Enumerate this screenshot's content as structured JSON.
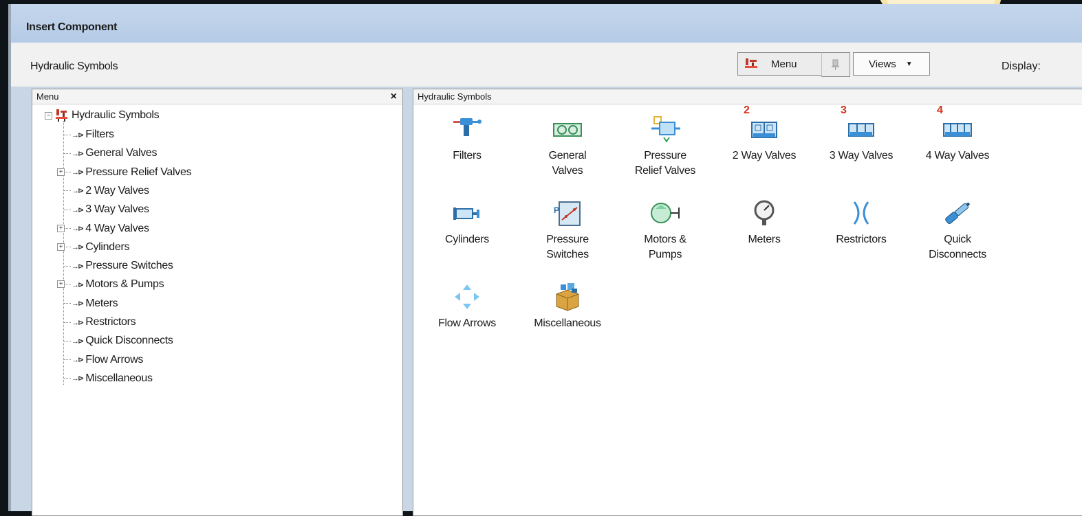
{
  "window": {
    "title": "Insert Component"
  },
  "toolbar": {
    "breadcrumb": "Hydraulic Symbols",
    "menu_button": "Menu",
    "views_button": "Views",
    "display_label": "Display:"
  },
  "left_pane": {
    "header": "Menu",
    "close_symbol": "×",
    "root": "Hydraulic Symbols",
    "items": [
      {
        "label": "Filters",
        "expandable": false
      },
      {
        "label": "General Valves",
        "expandable": false
      },
      {
        "label": "Pressure Relief Valves",
        "expandable": true
      },
      {
        "label": "2 Way Valves",
        "expandable": false
      },
      {
        "label": "3 Way Valves",
        "expandable": false
      },
      {
        "label": "4 Way Valves",
        "expandable": true
      },
      {
        "label": "Cylinders",
        "expandable": true
      },
      {
        "label": "Pressure Switches",
        "expandable": false
      },
      {
        "label": "Motors & Pumps",
        "expandable": true
      },
      {
        "label": "Meters",
        "expandable": false
      },
      {
        "label": "Restrictors",
        "expandable": false
      },
      {
        "label": "Quick Disconnects",
        "expandable": false
      },
      {
        "label": "Flow Arrows",
        "expandable": false
      },
      {
        "label": "Miscellaneous",
        "expandable": false
      }
    ]
  },
  "right_pane": {
    "header": "Hydraulic Symbols",
    "icons": [
      {
        "line1": "Filters",
        "line2": "",
        "icon": "filter-icon",
        "badge": ""
      },
      {
        "line1": "General",
        "line2": "Valves",
        "icon": "general-valve-icon",
        "badge": ""
      },
      {
        "line1": "Pressure",
        "line2": "Relief Valves",
        "icon": "pressure-relief-valve-icon",
        "badge": ""
      },
      {
        "line1": "2 Way Valves",
        "line2": "",
        "icon": "two-way-valve-icon",
        "badge": "2"
      },
      {
        "line1": "3 Way Valves",
        "line2": "",
        "icon": "three-way-valve-icon",
        "badge": "3"
      },
      {
        "line1": "4 Way Valves",
        "line2": "",
        "icon": "four-way-valve-icon",
        "badge": "4"
      },
      {
        "line1": "Cylinders",
        "line2": "",
        "icon": "cylinder-icon",
        "badge": ""
      },
      {
        "line1": "Pressure",
        "line2": "Switches",
        "icon": "pressure-switch-icon",
        "badge": ""
      },
      {
        "line1": "Motors &",
        "line2": "Pumps",
        "icon": "motor-pump-icon",
        "badge": ""
      },
      {
        "line1": "Meters",
        "line2": "",
        "icon": "gauge-icon",
        "badge": ""
      },
      {
        "line1": "Restrictors",
        "line2": "",
        "icon": "restrictor-icon",
        "badge": ""
      },
      {
        "line1": "Quick",
        "line2": "Disconnects",
        "icon": "quick-disconnect-icon",
        "badge": ""
      },
      {
        "line1": "Flow Arrows",
        "line2": "",
        "icon": "flow-arrows-icon",
        "badge": ""
      },
      {
        "line1": "Miscellaneous",
        "line2": "",
        "icon": "miscellaneous-box-icon",
        "badge": ""
      }
    ]
  },
  "colors": {
    "title_bar": "#c4d6ec",
    "badge_red": "#d4321c",
    "icon_blue": "#3a8fd6"
  }
}
